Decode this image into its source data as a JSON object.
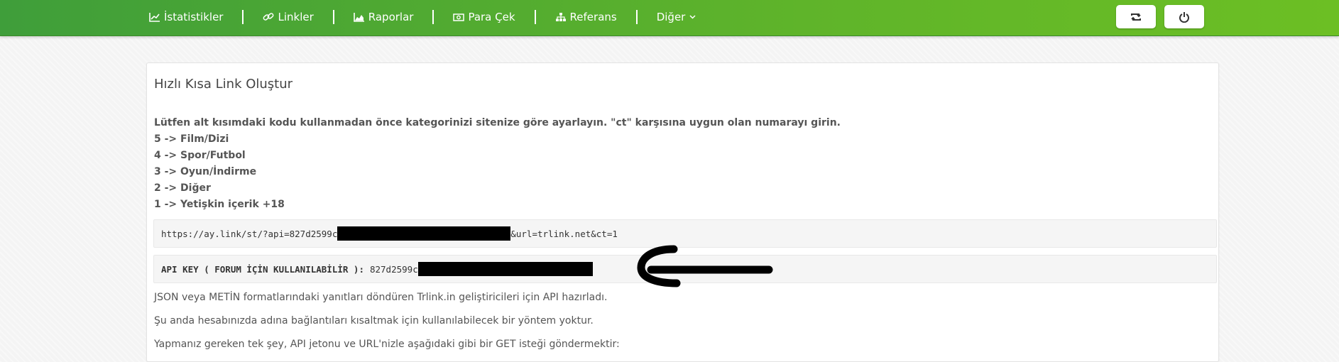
{
  "nav": {
    "items": [
      {
        "label": "İstatistikler",
        "icon": "line-chart-icon"
      },
      {
        "label": "Linkler",
        "icon": "link-icon"
      },
      {
        "label": "Raporlar",
        "icon": "area-chart-icon"
      },
      {
        "label": "Para Çek",
        "icon": "money-icon"
      },
      {
        "label": "Referans",
        "icon": "sitemap-icon"
      },
      {
        "label": "Diğer",
        "icon": "chevron-down-icon"
      }
    ],
    "buttons": [
      {
        "icon": "retweet-icon"
      },
      {
        "icon": "power-icon"
      }
    ]
  },
  "panel": {
    "title": "Hızlı Kısa Link Oluştur",
    "notice": "Lütfen alt kısımdaki kodu kullanmadan önce kategorinizi sitenize göre ayarlayın. \"ct\" karşısına uygun olan numarayı girin.",
    "categories": [
      "5 -> Film/Dizi",
      "4 -> Spor/Futbol",
      "3 -> Oyun/İndirme",
      "2 -> Diğer",
      "1 -> Yetişkin içerik +18"
    ],
    "url_prefix": "https://ay.link/st/?api=827d2599c",
    "url_suffix": "&url=trlink.net&ct=1",
    "api_key_label": "API KEY ( FORUM İÇİN KULLANILABİLİR ):",
    "api_key_prefix": "827d2599c",
    "paragraphs": [
      "JSON veya METİN formatlarındaki yanıtları döndüren Trlink.in geliştiricileri için API hazırladı.",
      "Şu anda hesabınızda adına bağlantıları kısaltmak için kullanılabilecek bir yöntem yoktur.",
      "Yapmanız gereken tek şey, API jetonu ve URL'nizle aşağıdaki gibi bir GET isteği göndermektir:"
    ]
  },
  "colors": {
    "header_green": "#5fb42a",
    "panel_bg": "#ffffff",
    "code_bg": "#f5f5f5"
  }
}
